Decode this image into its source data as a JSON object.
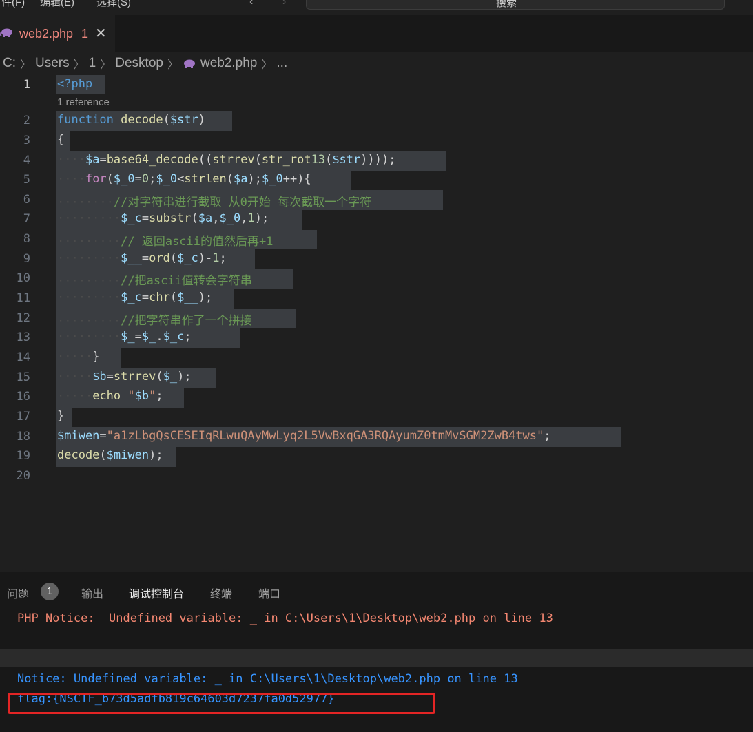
{
  "menu": {
    "items": [
      "件(F)",
      "编辑(E)",
      "选择(S)"
    ],
    "search_placeholder": "搜索"
  },
  "tab": {
    "label": "web2.php",
    "problem_count": "1",
    "close": "✕"
  },
  "breadcrumb": [
    "C:",
    "Users",
    "1",
    "Desktop",
    "web2.php",
    "..."
  ],
  "editor": {
    "codelens": "1 reference",
    "line_numbers": [
      "1",
      "2",
      "3",
      "4",
      "5",
      "6",
      "7",
      "8",
      "9",
      "10",
      "11",
      "12",
      "13",
      "14",
      "15",
      "16",
      "17",
      "18",
      "19",
      "20"
    ],
    "lines": [
      "<?php",
      "function decode($str)",
      "{",
      "$a=base64_decode((strrev(str_rot13($str))));",
      "for($_0=0;$_0<strlen($a);$_0++){",
      "//对字符串进行截取 从0开始 每次截取一个字符",
      "$_c=substr($a,$_0,1);",
      "// 返回ascii的值然后再+1",
      "$__=ord($_c)-1;",
      "//把ascii值转会字符串",
      "$_c=chr($__);",
      "//把字符串作了一个拼接",
      "$_=$_.$_c;",
      "}",
      "$b=strrev($_);",
      "echo \"$b\";",
      "}",
      "$miwen=\"a1zLbgQsCESEIqRLwuQAyMwLyq2L5VwBxqGA3RQAyumZ0tmMvSGM2ZwB4tws\";",
      "decode($miwen);",
      ""
    ]
  },
  "panel": {
    "tabs": [
      "问题",
      "输出",
      "调试控制台",
      "终端",
      "端口"
    ],
    "problems_badge": "1",
    "output": {
      "notice1": "PHP Notice:  Undefined variable: _ in C:\\Users\\1\\Desktop\\web2.php on line 13",
      "notice2": "Notice: Undefined variable: _ in C:\\Users\\1\\Desktop\\web2.php on line 13",
      "flag": "flag:{NSCTF_b73d5adfb819c64603d7237fa0d52977}"
    }
  },
  "colors": {
    "editor_bg": "#1f1f1f",
    "panel_bg": "#181818",
    "tab_error_text": "#f1897f",
    "notice_orange": "#f48771",
    "notice_blue": "#3794ff",
    "highlight_box": "#e32525"
  }
}
